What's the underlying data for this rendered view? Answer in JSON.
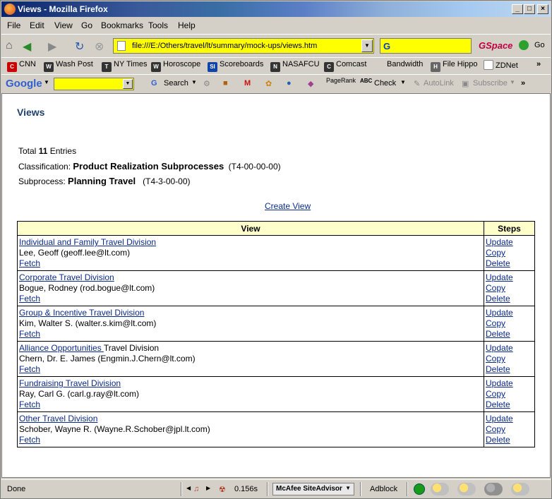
{
  "window": {
    "title": "Views - Mozilla Firefox"
  },
  "menu": [
    "File",
    "Edit",
    "View",
    "Go",
    "Bookmarks",
    "Tools",
    "Help"
  ],
  "nav": {
    "url": "file:///E:/Others/travel/lt/summary/mock-ups/views.htm",
    "gspace": "GSpace",
    "go_label": "Go"
  },
  "bookmarks": [
    {
      "label": "CNN",
      "icon": "cnn-icon"
    },
    {
      "label": "Wash Post",
      "icon": "wash-post-icon"
    },
    {
      "label": "NY Times",
      "icon": "ny-times-icon"
    },
    {
      "label": "Horoscope",
      "icon": "horoscope-icon"
    },
    {
      "label": "Scoreboards",
      "icon": "si-icon"
    },
    {
      "label": "NASAFCU",
      "icon": "nasafcu-icon"
    },
    {
      "label": "Comcast",
      "icon": "comcast-icon"
    },
    {
      "label": "Bandwidth",
      "icon": ""
    },
    {
      "label": "File Hippo",
      "icon": "file-hippo-icon"
    },
    {
      "label": "ZDNet",
      "icon": "zdnet-icon"
    }
  ],
  "google_toolbar": {
    "logo": "Google",
    "search": "Search",
    "pagerank": "PageRank",
    "check": "Check",
    "autolink": "AutoLink",
    "subscribe": "Subscribe"
  },
  "page": {
    "heading": "Views",
    "total_prefix": "Total",
    "total_count": "11",
    "total_suffix": "Entries",
    "classification_label": "Classification:",
    "classification_value": "Product Realization Subprocesses",
    "classification_code": "(T4-00-00-00)",
    "subprocess_label": "Subprocess:",
    "subprocess_value": "Planning Travel",
    "subprocess_code": "(T4-3-00-00)",
    "create_view": "Create View",
    "col_view": "View",
    "col_steps": "Steps",
    "rows": [
      {
        "link": "Individual and Family Travel Division",
        "link_tail": "",
        "person": "Lee, Geoff (geoff.lee@lt.com)",
        "fetch": "Fetch",
        "update": "Update",
        "copy": "Copy",
        "delete": "Delete"
      },
      {
        "link": "Corporate Travel Division",
        "link_tail": "",
        "person": "Bogue, Rodney (rod.bogue@lt.com)",
        "fetch": "Fetch",
        "update": "Update",
        "copy": "Copy",
        "delete": "Delete"
      },
      {
        "link": "Group & Incentive Travel Division",
        "link_tail": "",
        "person": "Kim, Walter S. (walter.s.kim@lt.com)",
        "fetch": "Fetch",
        "update": "Update",
        "copy": "Copy",
        "delete": "Delete"
      },
      {
        "link": "Alliance Opportunities ",
        "link_tail": "Travel Division",
        "person": "Chern, Dr. E. James (Engmin.J.Chern@lt.com)",
        "fetch": "Fetch",
        "update": "Update",
        "copy": "Copy",
        "delete": "Delete"
      },
      {
        "link": "Fundraising Travel Division",
        "link_tail": "",
        "person": "Ray, Carl G. (carl.g.ray@lt.com)",
        "fetch": "Fetch",
        "update": "Update",
        "copy": "Copy",
        "delete": "Delete"
      },
      {
        "link": "Other Travel Division",
        "link_tail": "",
        "person": "Schober, Wayne R. (Wayne.R.Schober@jpl.lt.com)",
        "fetch": "Fetch",
        "update": "Update",
        "copy": "Copy",
        "delete": "Delete"
      }
    ]
  },
  "statusbar": {
    "status": "Done",
    "timing": "0.156s",
    "mcafee": "McAfee SiteAdvisor",
    "adblock": "Adblock"
  }
}
